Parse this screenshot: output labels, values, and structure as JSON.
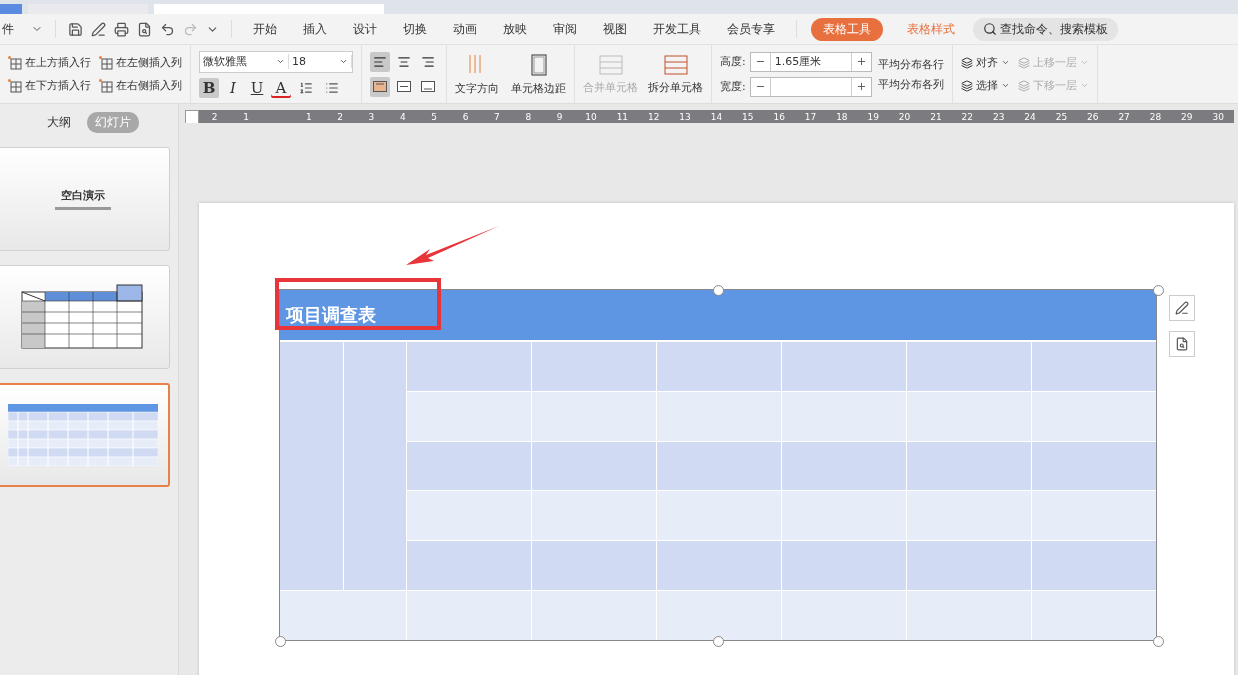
{
  "menu_bar": {
    "file_menu": "件",
    "tabs": [
      {
        "label": "开始",
        "selected": false
      },
      {
        "label": "插入",
        "selected": false
      },
      {
        "label": "设计",
        "selected": false
      },
      {
        "label": "切换",
        "selected": false
      },
      {
        "label": "动画",
        "selected": false
      },
      {
        "label": "放映",
        "selected": false
      },
      {
        "label": "审阅",
        "selected": false
      },
      {
        "label": "视图",
        "selected": false
      },
      {
        "label": "开发工具",
        "selected": false
      },
      {
        "label": "会员专享",
        "selected": false
      }
    ],
    "context_tabs": [
      {
        "label": "表格工具",
        "selected": true
      },
      {
        "label": "表格样式",
        "selected": false
      }
    ],
    "search": {
      "placeholder": "查找命令、搜索模板"
    }
  },
  "ribbon": {
    "insert_buttons": [
      "在上方插入行",
      "在左侧插入列",
      "在下方插入行",
      "在右侧插入列"
    ],
    "font": {
      "name": "微软雅黑",
      "size": "18"
    },
    "format_buttons": [
      {
        "label": "B",
        "selected": true
      },
      {
        "label": "I",
        "selected": false
      },
      {
        "label": "U",
        "selected": false
      },
      {
        "label": "A",
        "selected": false
      }
    ],
    "horizontal_align": [
      {
        "selected": true
      },
      {
        "selected": false
      },
      {
        "selected": false
      }
    ],
    "vertical_align": [
      {
        "selected": true
      },
      {
        "selected": false
      },
      {
        "selected": false
      }
    ],
    "text_direction": "文字方向",
    "cell_margin": "单元格边距",
    "merge_cells": {
      "label": "合并单元格",
      "disabled": true
    },
    "split_cells": {
      "label": "拆分单元格",
      "disabled": false
    },
    "height": {
      "label": "高度:",
      "value": "1.65厘米"
    },
    "width": {
      "label": "宽度:"
    },
    "distribute_rows": "平均分布各行",
    "distribute_columns": "平均分布各列",
    "arrange": [
      {
        "label": "对齐",
        "disabled": false
      },
      {
        "label": "上移一层",
        "disabled": true
      },
      {
        "label": "选择",
        "disabled": false
      },
      {
        "label": "下移一层",
        "disabled": true
      }
    ]
  },
  "ruler": {
    "left_labels": [
      "2",
      "1"
    ],
    "labels": [
      "1",
      "2",
      "3",
      "4",
      "5",
      "6",
      "7",
      "8",
      "9",
      "10",
      "11",
      "12",
      "13",
      "14",
      "15",
      "16",
      "17",
      "18",
      "19",
      "20",
      "21",
      "22",
      "23",
      "24",
      "25",
      "26",
      "27",
      "28",
      "29",
      "30"
    ]
  },
  "sidebar": {
    "tabs": [
      {
        "label": "大纲",
        "selected": false
      },
      {
        "label": "幻灯片",
        "selected": true
      }
    ],
    "slides": [
      {
        "kind": "title",
        "title": "空白演示",
        "selected": false
      },
      {
        "kind": "grid",
        "selected": false
      },
      {
        "kind": "table",
        "selected": true
      }
    ]
  },
  "slide": {
    "table": {
      "title": "项目调查表"
    }
  }
}
